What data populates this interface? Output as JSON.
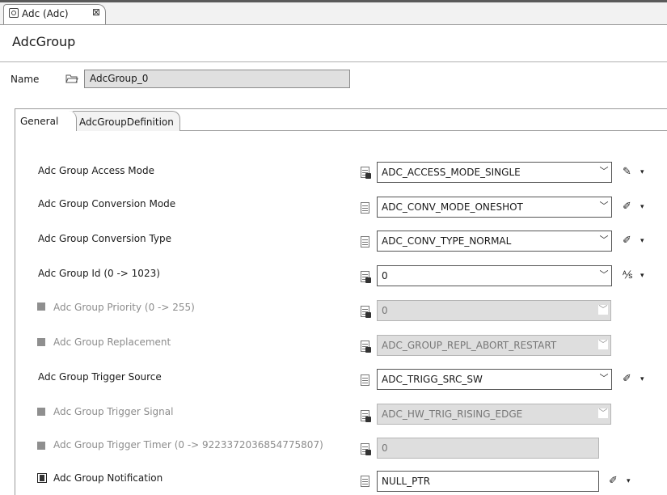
{
  "editor": {
    "tab_title": "Adc (Adc)",
    "tab_close": "⊠",
    "title": "AdcGroup"
  },
  "name": {
    "label": "Name",
    "value": "AdcGroup_0"
  },
  "tabs": [
    {
      "label": "General"
    },
    {
      "label": "AdcGroupDefinition"
    }
  ],
  "properties": [
    {
      "label": "Adc Group Access Mode",
      "value": "ADC_ACCESS_MODE_SINGLE",
      "control": "combo",
      "enabled": true,
      "action_icon": "pencil-icon"
    },
    {
      "label": "Adc Group Conversion Mode",
      "value": "ADC_CONV_MODE_ONESHOT",
      "control": "combo",
      "enabled": true,
      "action_icon": "wrench-icon"
    },
    {
      "label": "Adc Group Conversion Type",
      "value": "ADC_CONV_TYPE_NORMAL",
      "control": "combo",
      "enabled": true,
      "action_icon": "wrench-icon"
    },
    {
      "label": "Adc Group Id (0 -> 1023)",
      "value": "0",
      "control": "combo",
      "enabled": true,
      "action_icon": "calculated-icon"
    },
    {
      "label": "Adc Group Priority (0 -> 255)",
      "value": "0",
      "control": "combo",
      "enabled": false
    },
    {
      "label": "Adc Group Replacement",
      "value": "ADC_GROUP_REPL_ABORT_RESTART",
      "control": "combo",
      "enabled": false
    },
    {
      "label": "Adc Group Trigger Source",
      "value": "ADC_TRIGG_SRC_SW",
      "control": "combo",
      "enabled": true,
      "action_icon": "wrench-icon"
    },
    {
      "label": "Adc Group Trigger Signal",
      "value": "ADC_HW_TRIG_RISING_EDGE",
      "control": "combo",
      "enabled": false
    },
    {
      "label": "Adc Group Trigger Timer (0 -> 9223372036854775807)",
      "value": "0",
      "control": "text",
      "enabled": false
    },
    {
      "label": "Adc Group Notification",
      "value": "NULL_PTR",
      "control": "text",
      "enabled": true,
      "action_icon": "wrench-icon"
    }
  ],
  "icons": {
    "dropdown": "﹀",
    "menu_arrow": "▾",
    "pencil": "✎",
    "wrench": "✐",
    "calculated": "⅍"
  }
}
